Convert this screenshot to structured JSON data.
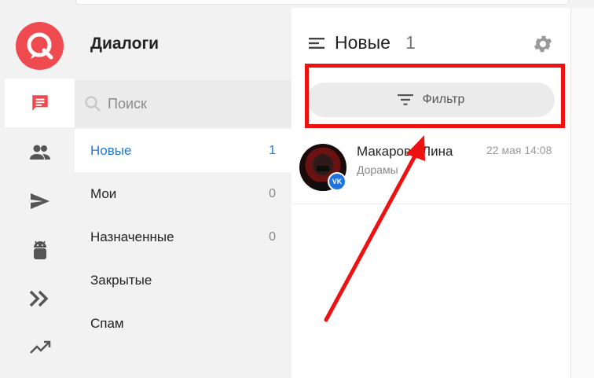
{
  "rail": {
    "items": [
      {
        "icon": "chat-icon",
        "active": true
      },
      {
        "icon": "users-icon"
      },
      {
        "icon": "send-icon"
      },
      {
        "icon": "android-icon"
      },
      {
        "icon": "double-chevron-icon"
      },
      {
        "icon": "trending-icon"
      }
    ],
    "accent": "#ef4a4f"
  },
  "folders": {
    "title": "Диалоги",
    "search_placeholder": "Поиск",
    "items": [
      {
        "label": "Новые",
        "count": "1",
        "active": true
      },
      {
        "label": "Мои",
        "count": "0"
      },
      {
        "label": "Назначенные",
        "count": "0"
      },
      {
        "label": "Закрытые",
        "count": ""
      },
      {
        "label": "Спам",
        "count": ""
      }
    ]
  },
  "panel": {
    "title": "Новые",
    "count": "1",
    "filter_label": "Фильтр"
  },
  "dialogs": [
    {
      "name": "Макарова Лина",
      "time": "22 мая 14:08",
      "message": "Дорамы",
      "channel_badge": "VK"
    }
  ],
  "colors": {
    "active_link": "#2079d6",
    "annotation": "#ee1111"
  }
}
